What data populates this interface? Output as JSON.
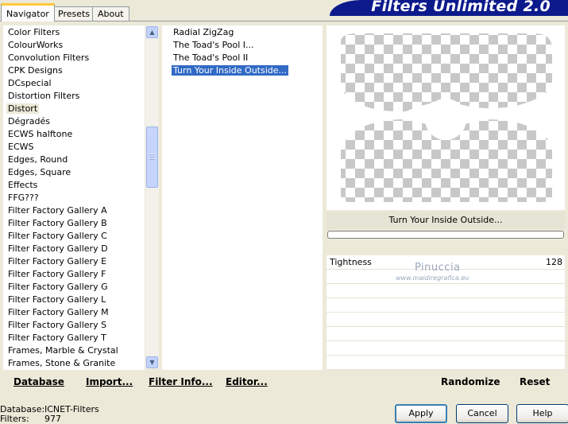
{
  "tabs": [
    "Navigator",
    "Presets",
    "About"
  ],
  "banner": "Filters Unlimited 2.0",
  "categories": [
    "Color Filters",
    "ColourWorks",
    "Convolution Filters",
    "CPK Designs",
    "DCspecial",
    "Distortion Filters",
    "Distort",
    "Dégradés",
    "ECWS halftone",
    "ECWS",
    "Edges, Round",
    "Edges, Square",
    "Effects",
    "FFG???",
    "Filter Factory Gallery A",
    "Filter Factory Gallery B",
    "Filter Factory Gallery C",
    "Filter Factory Gallery D",
    "Filter Factory Gallery E",
    "Filter Factory Gallery F",
    "Filter Factory Gallery G",
    "Filter Factory Gallery L",
    "Filter Factory Gallery M",
    "Filter Factory Gallery S",
    "Filter Factory Gallery T",
    "Frames, Marble & Crystal",
    "Frames, Stone & Granite"
  ],
  "selected_category": "Distort",
  "filters": [
    "Radial ZigZag",
    "The Toad's Pool I...",
    "The Toad's Pool II",
    "Turn Your Inside Outside..."
  ],
  "selected_filter": "Turn Your Inside Outside...",
  "preview_title": "Turn Your Inside Outside...",
  "params": [
    {
      "name": "Tightness",
      "value": "128"
    }
  ],
  "watermark": {
    "name": "Pinuccia",
    "site": "www.maidiregrafica.eu"
  },
  "bottom_links": {
    "database": "Database",
    "import": "Import...",
    "filter_info": "Filter Info...",
    "editor": "Editor...",
    "randomize": "Randomize",
    "reset": "Reset"
  },
  "status": {
    "database_label": "Database:",
    "database_value": "ICNET-Filters",
    "filters_label": "Filters:",
    "filters_value": "977"
  },
  "buttons": {
    "apply": "Apply",
    "cancel": "Cancel",
    "help": "Help"
  }
}
